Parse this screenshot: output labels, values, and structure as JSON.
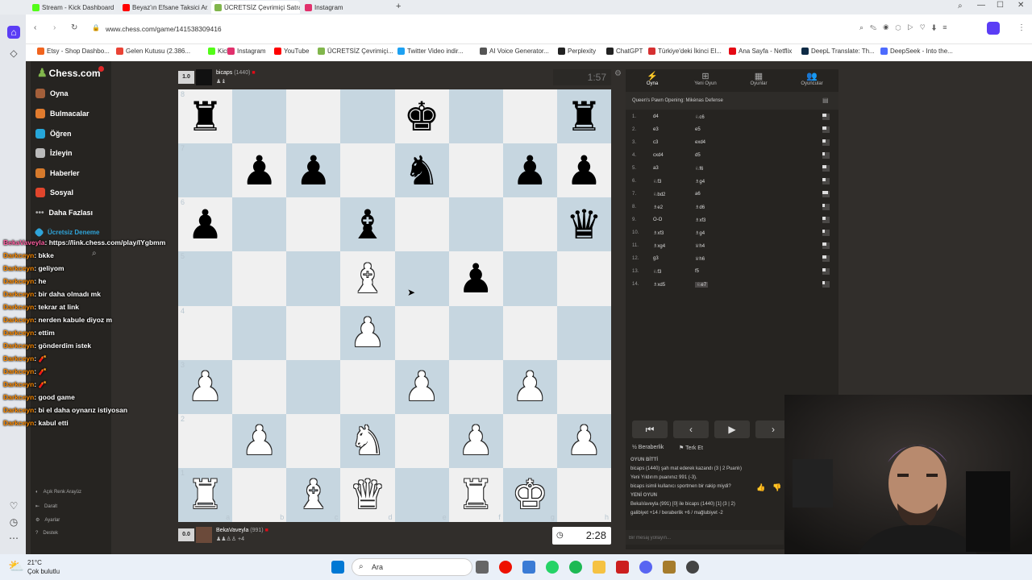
{
  "browser": {
    "tabs": [
      {
        "label": "Stream - Kick Dashboard",
        "icon": "kick-icon",
        "color": "#53fc18"
      },
      {
        "label": "Beyaz'ın Efsane Taksici Ar...",
        "icon": "youtube-icon",
        "color": "#ff0000"
      },
      {
        "label": "ÜCRETSİZ Çevrimiçi Satran...",
        "icon": "chess-icon",
        "color": "#81b64c",
        "active": true
      },
      {
        "label": "Instagram",
        "icon": "instagram-icon",
        "color": "#e1306c"
      }
    ],
    "url": "www.chess.com/game/141538309416",
    "bookmarks": [
      {
        "label": "Etsy - Shop Dashbo...",
        "color": "#f1641e"
      },
      {
        "label": "Gelen Kutusu (2.386...",
        "color": "#ea4335"
      },
      {
        "label": "Kick",
        "color": "#53fc18"
      },
      {
        "label": "Instagram",
        "color": "#e1306c"
      },
      {
        "label": "YouTube",
        "color": "#ff0000"
      },
      {
        "label": "ÜCRETSİZ Çevrimiçi...",
        "color": "#81b64c"
      },
      {
        "label": "Twitter Video indir...",
        "color": "#1da1f2"
      },
      {
        "label": "AI Voice Generator...",
        "color": "#555555"
      },
      {
        "label": "Perplexity",
        "color": "#222222"
      },
      {
        "label": "ChatGPT",
        "color": "#222222"
      },
      {
        "label": "Türkiye'deki İkinci El...",
        "color": "#d63031"
      },
      {
        "label": "Ana Sayfa - Netflix",
        "color": "#e50914"
      },
      {
        "label": "DeepL Translate: Th...",
        "color": "#0f2b46"
      },
      {
        "label": "DeepSeek - Into the...",
        "color": "#4d6bfe"
      }
    ]
  },
  "site": {
    "logo": "Chess.com",
    "nav": [
      "Oyna",
      "Bulmacalar",
      "Öğren",
      "İzleyin",
      "Haberler",
      "Sosyal",
      "Daha Fazlası",
      "Ücretsiz Deneme"
    ],
    "bottom_nav": [
      "Açık Renk Arayüz",
      "Daralt",
      "Ayarlar",
      "Destek"
    ]
  },
  "top_player": {
    "score": "1.0",
    "name": "bicaps",
    "rating": "(1440)",
    "clock": "1:57"
  },
  "bottom_player": {
    "score": "0.0",
    "name": "BekaVaveyla",
    "rating": "(991)",
    "clock": "2:28",
    "material": "+4"
  },
  "board": {
    "rows": [
      [
        "bR",
        "",
        "",
        "",
        "bK",
        "",
        "",
        "bR"
      ],
      [
        "",
        "bP",
        "bP",
        "",
        "bN",
        "",
        "bP",
        "bP"
      ],
      [
        "bP",
        "",
        "",
        "bB",
        "",
        "",
        "",
        "bQ"
      ],
      [
        "",
        "",
        "",
        "wB",
        "",
        "bP",
        "",
        ""
      ],
      [
        "",
        "",
        "",
        "wP",
        "",
        "",
        "",
        ""
      ],
      [
        "wP",
        "",
        "",
        "",
        "wP",
        "",
        "wP",
        ""
      ],
      [
        "",
        "wP",
        "",
        "wN",
        "",
        "wP",
        "",
        "wP"
      ],
      [
        "wR",
        "",
        "wB",
        "wQ",
        "",
        "wR",
        "wK",
        ""
      ]
    ],
    "ranks": [
      "8",
      "7",
      "6",
      "5",
      "4",
      "3",
      "2",
      "1"
    ],
    "files": [
      "a",
      "b",
      "c",
      "d",
      "e",
      "f",
      "g",
      "h"
    ],
    "colors": {
      "light": "#f0f0f0",
      "dark": "#c6d6e0"
    }
  },
  "panel": {
    "tabs": [
      "Oyna",
      "Yeni Oyun",
      "Oyunlar",
      "Oyuncular"
    ],
    "opening": "Queen's Pawn Opening: Mikėnas Defense",
    "moves": [
      {
        "n": "1.",
        "w": "d4",
        "b": "♘c6",
        "t": 0.6
      },
      {
        "n": "2.",
        "w": "e3",
        "b": "e5",
        "t": 0.5
      },
      {
        "n": "3.",
        "w": "c3",
        "b": "exd4",
        "t": 0.4
      },
      {
        "n": "4.",
        "w": "cxd4",
        "b": "d5",
        "t": 0.3
      },
      {
        "n": "5.",
        "w": "a3",
        "b": "♘f6",
        "t": 0.5
      },
      {
        "n": "6.",
        "w": "♘f3",
        "b": "♗g4",
        "t": 0.4
      },
      {
        "n": "7.",
        "w": "♘bd2",
        "b": "a6",
        "t": 0.8
      },
      {
        "n": "8.",
        "w": "♗e2",
        "b": "♗d6",
        "t": 0.3
      },
      {
        "n": "9.",
        "w": "O-O",
        "b": "♗xf3",
        "t": 0.4
      },
      {
        "n": "10.",
        "w": "♗xf3",
        "b": "♗g4",
        "t": 0.3
      },
      {
        "n": "11.",
        "w": "♗xg4",
        "b": "♕h4",
        "t": 0.5
      },
      {
        "n": "12.",
        "w": "g3",
        "b": "♕h6",
        "t": 0.6
      },
      {
        "n": "13.",
        "w": "♘f3",
        "b": "f5",
        "t": 0.4
      },
      {
        "n": "14.",
        "w": "♗xd5",
        "b": "♘e7",
        "t": 0.3
      }
    ],
    "actions": {
      "draw": "Beraberlik",
      "resign": "Terk Et"
    },
    "chat": [
      {
        "text": "OYUN BİTTİ",
        "bold": true
      },
      {
        "text": "bicaps (1440) şah mat ederek kazandı (3 | 2 Puanlı)"
      },
      {
        "text": "Yeni Yıldırım puanınız 991 (-3)."
      },
      {
        "text": "bicaps isimli kullanıcı sportmen bir rakip miydi?"
      },
      {
        "text": "YENİ OYUN",
        "bold": true
      },
      {
        "text": "BekaVaveyla (991) [0] ile bicaps (1440) [1] (3 | 2)"
      },
      {
        "text": "galibiyet +14 / beraberlik +6 / mağlubiyet -2"
      }
    ],
    "message_placeholder": "Bir mesaj yollayın..."
  },
  "stream_chat": {
    "link_line": {
      "user": "BekaVaveyla",
      "text": ": https://link.chess.com/play/IYgbmm"
    },
    "messages": [
      {
        "user": "Darkceyn",
        "text": ": bkke"
      },
      {
        "user": "Darkceyn",
        "text": ": geliyom"
      },
      {
        "user": "Darkceyn",
        "text": ": he"
      },
      {
        "user": "Darkceyn",
        "text": ": bir daha olmadı mk"
      },
      {
        "user": "Darkceyn",
        "text": ": tekrar at link"
      },
      {
        "user": "Darkceyn",
        "text": ": nerden kabule diyoz m"
      },
      {
        "user": "Darkceyn",
        "text": ": ettim"
      },
      {
        "user": "Darkceyn",
        "text": ": gönderdim istek"
      },
      {
        "user": "Darkceyn",
        "text": ": 🧨"
      },
      {
        "user": "Darkceyn",
        "text": ": 🧨"
      },
      {
        "user": "Darkceyn",
        "text": ": 🧨"
      },
      {
        "user": "Darkceyn",
        "text": ": good game"
      },
      {
        "user": "Darkceyn",
        "text": ": bi el daha oynarız istiyosan"
      },
      {
        "user": "Darkceyn",
        "text": ": kabul etti"
      }
    ]
  },
  "taskbar": {
    "weather_temp": "21°C",
    "weather_desc": "Çok bulutlu",
    "search_label": "Ara"
  }
}
